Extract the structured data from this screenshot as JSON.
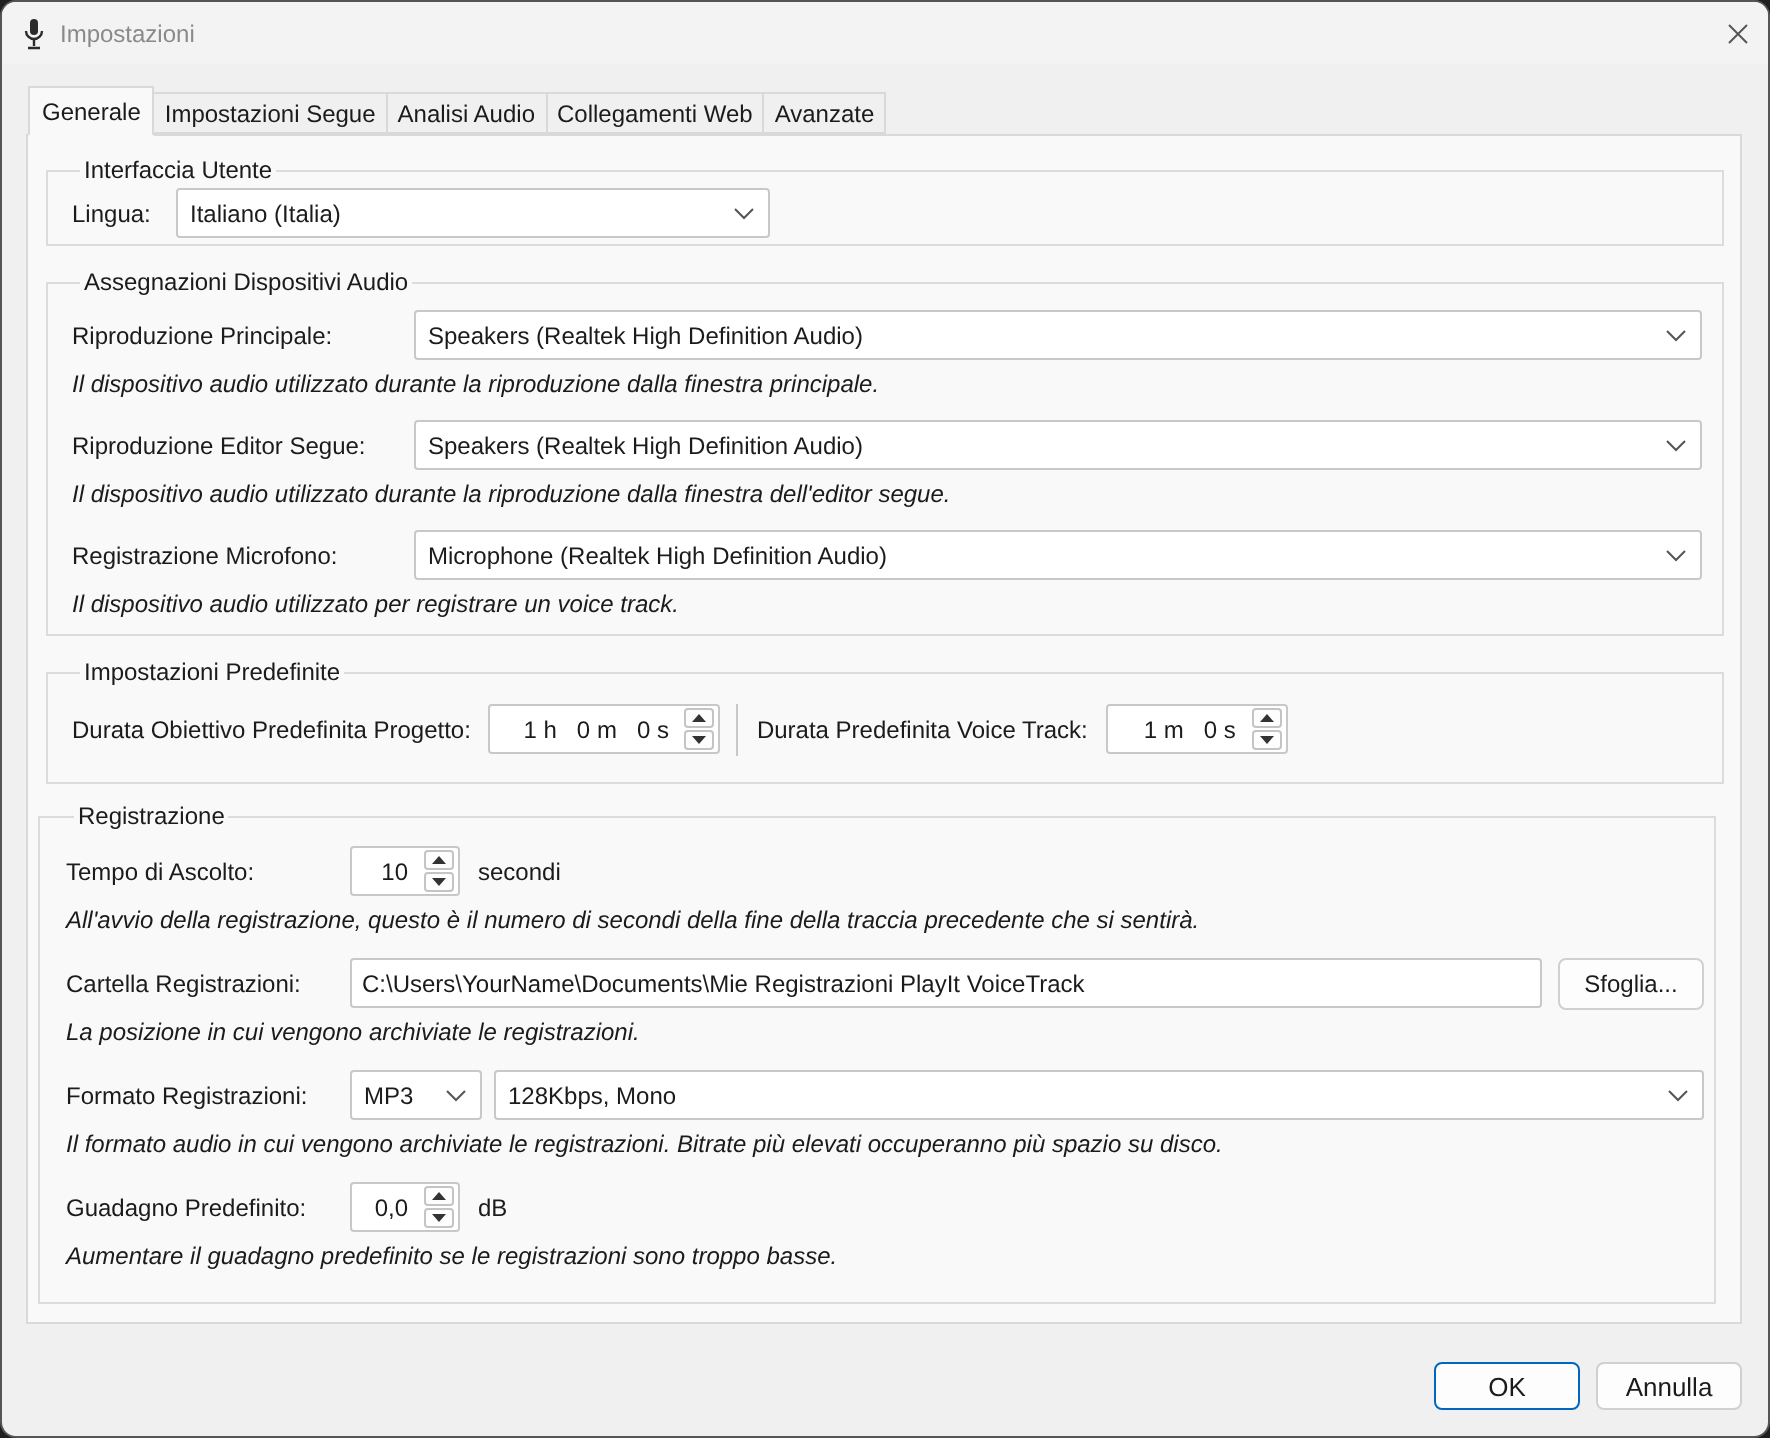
{
  "window": {
    "title": "Impostazioni"
  },
  "tabs": [
    {
      "label": "Generale",
      "selected": true
    },
    {
      "label": "Impostazioni Segue",
      "selected": false
    },
    {
      "label": "Analisi Audio",
      "selected": false
    },
    {
      "label": "Collegamenti Web",
      "selected": false
    },
    {
      "label": "Avanzate",
      "selected": false
    }
  ],
  "groups": [
    {
      "kind": "interface",
      "title": "Interfaccia Utente",
      "rows": [
        {
          "kind": "select",
          "label": "Lingua:",
          "value": "Italiano (Italia)"
        }
      ]
    },
    {
      "kind": "devices",
      "title": "Assegnazioni Dispositivi Audio",
      "rows": [
        {
          "kind": "select",
          "label": "Riproduzione Principale:",
          "value": "Speakers (Realtek High Definition Audio)",
          "description": "Il dispositivo audio utilizzato durante la riproduzione dalla finestra principale."
        },
        {
          "kind": "select",
          "label": "Riproduzione Editor Segue:",
          "value": "Speakers (Realtek High Definition Audio)",
          "description": "Il dispositivo audio utilizzato durante la riproduzione dalla finestra dell'editor segue."
        },
        {
          "kind": "select",
          "label": "Registrazione Microfono:",
          "value": "Microphone (Realtek High Definition Audio)",
          "description": "Il dispositivo audio utilizzato per registrare un voice track."
        }
      ]
    },
    {
      "kind": "defaults",
      "title": "Impostazioni Predefinite",
      "rows": [
        {
          "kind": "durations",
          "items": [
            {
              "label": "Durata Obiettivo Predefinita Progetto:",
              "value": "1 h   0 m   0 s"
            },
            {
              "label": "Durata Predefinita Voice Track:",
              "value": "1 m   0 s"
            }
          ]
        }
      ]
    },
    {
      "kind": "recording",
      "title": "Registrazione",
      "rows": [
        {
          "kind": "spin",
          "label": "Tempo di Ascolto:",
          "value": "10",
          "unit": "secondi",
          "description": "All'avvio della registrazione, questo è il numero di secondi della fine della traccia precedente che si sentirà."
        },
        {
          "kind": "folder",
          "label": "Cartella Registrazioni:",
          "value": "C:\\Users\\YourName\\Documents\\Mie Registrazioni PlayIt VoiceTrack",
          "button": "Sfoglia...",
          "description": "La posizione in cui vengono archiviate le registrazioni."
        },
        {
          "kind": "format",
          "label": "Formato Registrazioni:",
          "format": "MP3",
          "quality": "128Kbps, Mono",
          "description": "Il formato audio in cui vengono archiviate le registrazioni. Bitrate più elevati occuperanno più spazio su disco."
        },
        {
          "kind": "spin",
          "label": "Guadagno Predefinito:",
          "value": "0,0",
          "unit": "dB",
          "description": "Aumentare il guadagno predefinito se le registrazioni sono troppo basse."
        }
      ]
    }
  ],
  "buttons": [
    {
      "label": "OK",
      "default": true
    },
    {
      "label": "Annulla",
      "default": false
    }
  ]
}
